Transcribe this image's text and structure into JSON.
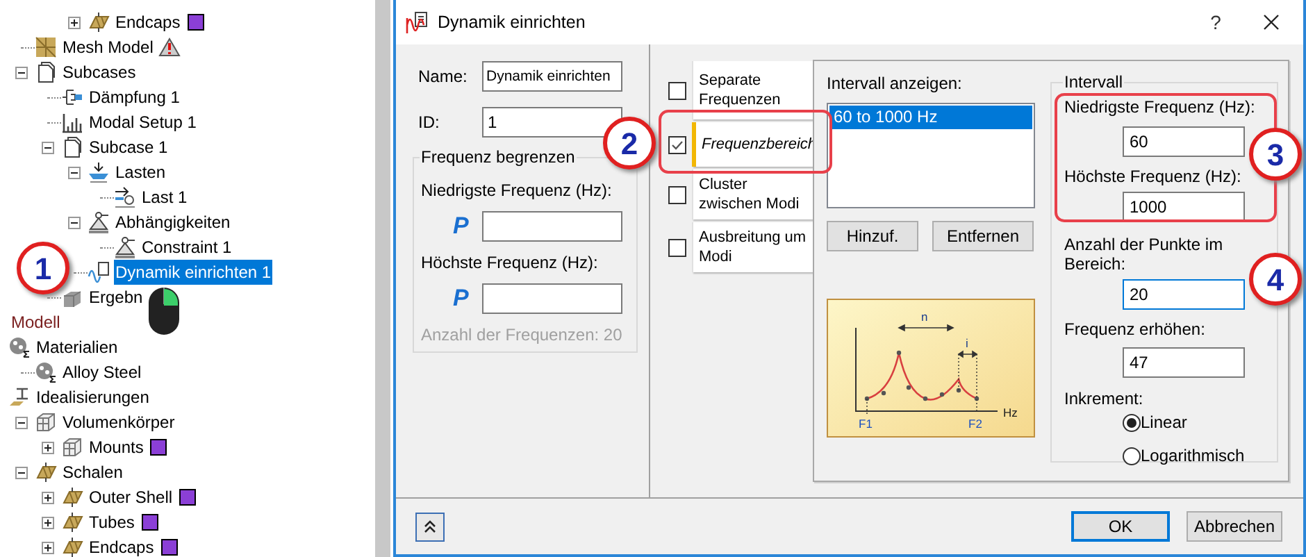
{
  "tree": [
    {
      "children": [
        {
          "children": [
            {
              "children": [
                {
                  "label": "Endcaps",
                  "kind": "part",
                  "expanded": false,
                  "color": "#8b3fd6",
                  "selected": false
                }
              ]
            }
          ]
        },
        {
          "label": "Mesh Model",
          "kind": "mesh",
          "warning": true,
          "selected": false
        },
        {
          "label": "Subcases",
          "kind": "subcases",
          "expanded": true,
          "selected": false,
          "children": [
            {
              "label": "Dämpfung 1",
              "kind": "damping",
              "selected": false
            },
            {
              "label": "Modal Setup 1",
              "kind": "modal",
              "selected": false
            },
            {
              "label": "Subcase 1",
              "kind": "subcases",
              "expanded": true,
              "selected": false,
              "children": [
                {
                  "label": "Lasten",
                  "kind": "loads",
                  "expanded": true,
                  "selected": false,
                  "children": [
                    {
                      "label": "Last 1",
                      "kind": "load",
                      "selected": false
                    }
                  ]
                },
                {
                  "label": "Abhängigkeiten",
                  "kind": "constraint",
                  "expanded": true,
                  "selected": false,
                  "children": [
                    {
                      "label": "Constraint 1",
                      "kind": "constraint",
                      "selected": false
                    }
                  ]
                },
                {
                  "label": "Dynamik einrichten 1",
                  "kind": "dynamic",
                  "selected": true
                }
              ]
            },
            {
              "label": "Ergebn",
              "kind": "results",
              "selected": false
            }
          ]
        }
      ]
    },
    {
      "label": "Modell",
      "kind": "header"
    },
    {
      "label": "Materialien",
      "kind": "material",
      "selected": false,
      "children": [
        {
          "label": "Alloy Steel",
          "kind": "material",
          "selected": false
        }
      ]
    },
    {
      "label": "Idealisierungen",
      "kind": "idealization",
      "selected": false,
      "children": [
        {
          "label": "Volumenkörper",
          "kind": "solid",
          "expanded": true,
          "selected": false,
          "children": [
            {
              "label": "Mounts",
              "kind": "solid",
              "expanded": false,
              "color": "#8b3fd6",
              "selected": false
            }
          ]
        },
        {
          "label": "Schalen",
          "kind": "part",
          "expanded": true,
          "selected": false,
          "children": [
            {
              "label": "Outer Shell",
              "kind": "part",
              "expanded": false,
              "color": "#8b3fd6",
              "selected": false
            },
            {
              "label": "Tubes",
              "kind": "part",
              "expanded": false,
              "color": "#8b3fd6",
              "selected": false
            },
            {
              "label": "Endcaps",
              "kind": "part",
              "expanded": false,
              "color": "#8b3fd6",
              "selected": false
            }
          ]
        }
      ]
    }
  ],
  "dialog": {
    "title": "Dynamik einrichten",
    "help": "?",
    "name_label": "Name:",
    "name_value": "Dynamik einrichten",
    "id_label": "ID:",
    "id_value": "1",
    "limit": {
      "title": "Frequenz begrenzen",
      "fields": [
        {
          "label": "Niedrigste Frequenz (Hz):",
          "param": "P"
        },
        {
          "label": "Höchste Frequenz (Hz):",
          "param": "P"
        }
      ],
      "note": "Anzahl der Frequenzen: 20",
      "note_disabled": true
    },
    "tabs": [
      {
        "label": "Separate Frequenzen",
        "checked": false,
        "selected": false
      },
      {
        "label": "Frequenzbereich",
        "checked": true,
        "selected": true
      },
      {
        "label": "Cluster zwischen Modi",
        "checked": false,
        "selected": false
      },
      {
        "label": "Ausbreitung um Modi",
        "checked": false,
        "selected": false
      }
    ],
    "interval_list": {
      "label": "Intervall anzeigen:",
      "items": [
        {
          "text": "60 to 1000 Hz",
          "selected": true
        }
      ]
    },
    "list_buttons": [
      "Hinzuf.",
      "Entfernen"
    ],
    "diagram": {
      "spacing": "n",
      "increment": "i",
      "start": "F1",
      "end": "F2",
      "unit": "Hz"
    },
    "interval": {
      "title": "Intervall",
      "fields": [
        {
          "label": "Niedrigste Frequenz (Hz):",
          "value": "60",
          "focused": false
        },
        {
          "label": "Höchste Frequenz (Hz):",
          "value": "1000",
          "focused": false
        },
        {
          "label": "Anzahl der Punkte im Bereich:",
          "value": "20",
          "focused": true
        },
        {
          "label": "Frequenz erhöhen:",
          "value": "47",
          "focused": false
        }
      ],
      "increment_label": "Inkrement:",
      "options": [
        {
          "label": "Linear",
          "selected": true
        },
        {
          "label": "Logarithmisch",
          "selected": false
        }
      ]
    },
    "footer_buttons": [
      {
        "label": "OK",
        "default": true
      },
      {
        "label": "Abbrechen",
        "default": false
      }
    ]
  },
  "callouts": [
    {
      "label": "1"
    },
    {
      "label": "2"
    },
    {
      "label": "3"
    },
    {
      "label": "4"
    }
  ]
}
